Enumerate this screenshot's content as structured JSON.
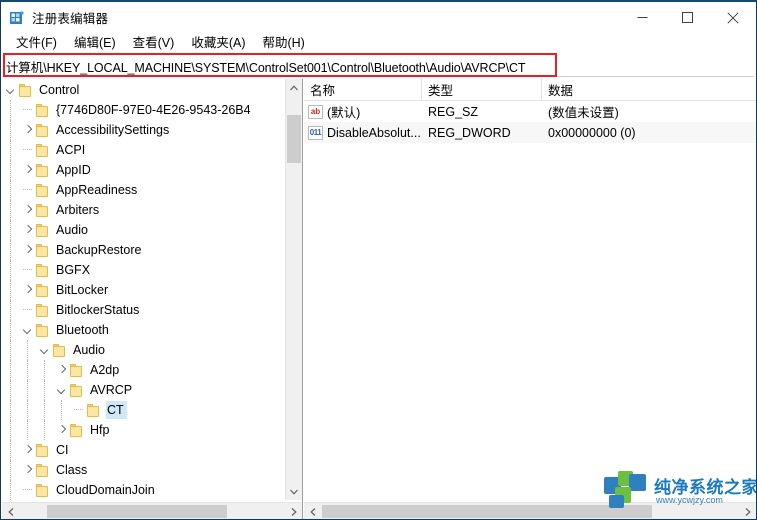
{
  "window": {
    "title": "注册表编辑器",
    "icon": "registry-editor-icon",
    "minimize_label": "最小化",
    "maximize_label": "最大化",
    "close_label": "关闭"
  },
  "menubar": {
    "items": [
      {
        "label": "文件(F)"
      },
      {
        "label": "编辑(E)"
      },
      {
        "label": "查看(V)"
      },
      {
        "label": "收藏夹(A)"
      },
      {
        "label": "帮助(H)"
      }
    ]
  },
  "address": {
    "value": "计算机\\HKEY_LOCAL_MACHINE\\SYSTEM\\ControlSet001\\Control\\Bluetooth\\Audio\\AVRCP\\CT",
    "placeholder": "",
    "highlight_color": "#ee1c25"
  },
  "tree": {
    "items": [
      {
        "label": "Control",
        "depth": 0,
        "twisty": "expanded",
        "selected": false
      },
      {
        "label": "{7746D80F-97E0-4E26-9543-26B4",
        "depth": 1,
        "twisty": "none",
        "selected": false
      },
      {
        "label": "AccessibilitySettings",
        "depth": 1,
        "twisty": "collapsed",
        "selected": false
      },
      {
        "label": "ACPI",
        "depth": 1,
        "twisty": "none",
        "selected": false
      },
      {
        "label": "AppID",
        "depth": 1,
        "twisty": "collapsed",
        "selected": false
      },
      {
        "label": "AppReadiness",
        "depth": 1,
        "twisty": "none",
        "selected": false
      },
      {
        "label": "Arbiters",
        "depth": 1,
        "twisty": "collapsed",
        "selected": false
      },
      {
        "label": "Audio",
        "depth": 1,
        "twisty": "collapsed",
        "selected": false
      },
      {
        "label": "BackupRestore",
        "depth": 1,
        "twisty": "collapsed",
        "selected": false
      },
      {
        "label": "BGFX",
        "depth": 1,
        "twisty": "none",
        "selected": false
      },
      {
        "label": "BitLocker",
        "depth": 1,
        "twisty": "collapsed",
        "selected": false
      },
      {
        "label": "BitlockerStatus",
        "depth": 1,
        "twisty": "none",
        "selected": false
      },
      {
        "label": "Bluetooth",
        "depth": 1,
        "twisty": "expanded",
        "selected": false
      },
      {
        "label": "Audio",
        "depth": 2,
        "twisty": "expanded",
        "selected": false
      },
      {
        "label": "A2dp",
        "depth": 3,
        "twisty": "collapsed",
        "selected": false
      },
      {
        "label": "AVRCP",
        "depth": 3,
        "twisty": "expanded",
        "selected": false
      },
      {
        "label": "CT",
        "depth": 4,
        "twisty": "none",
        "selected": true
      },
      {
        "label": "Hfp",
        "depth": 3,
        "twisty": "collapsed",
        "selected": false
      },
      {
        "label": "CI",
        "depth": 1,
        "twisty": "collapsed",
        "selected": false
      },
      {
        "label": "Class",
        "depth": 1,
        "twisty": "collapsed",
        "selected": false
      },
      {
        "label": "CloudDomainJoin",
        "depth": 1,
        "twisty": "none",
        "selected": false
      }
    ]
  },
  "list": {
    "columns": [
      {
        "label": "名称"
      },
      {
        "label": "类型"
      },
      {
        "label": "数据"
      }
    ],
    "rows": [
      {
        "icon": "string-value-icon",
        "icon_glyph": "ab",
        "name": "(默认)",
        "type": "REG_SZ",
        "data": "(数值未设置)"
      },
      {
        "icon": "dword-value-icon",
        "icon_glyph": "011",
        "name": "DisableAbsolut...",
        "type": "REG_DWORD",
        "data": "0x00000000 (0)"
      }
    ]
  },
  "watermark": {
    "title": "纯净系统之家",
    "url": "www.ycwjzy.com"
  }
}
